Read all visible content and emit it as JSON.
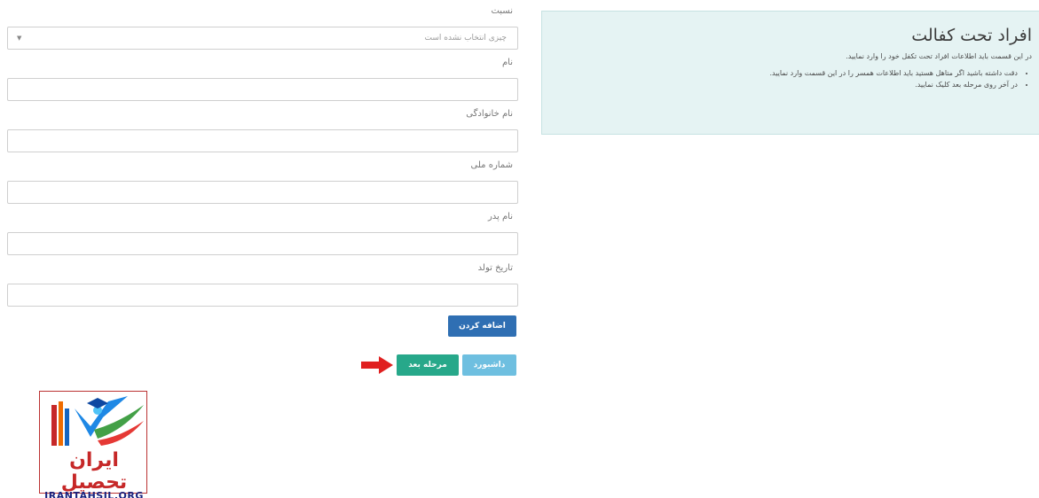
{
  "form": {
    "relation": {
      "label": "نسبت",
      "placeholder": "چیزی انتخاب نشده است"
    },
    "first_name": {
      "label": "نام",
      "value": ""
    },
    "last_name": {
      "label": "نام خانوادگی",
      "value": ""
    },
    "national_id": {
      "label": "شماره ملی",
      "value": ""
    },
    "father_name": {
      "label": "نام پدر",
      "value": ""
    },
    "birth_date": {
      "label": "تاریخ تولد",
      "value": ""
    },
    "add_button": "اضافه کردن",
    "dashboard_button": "داشبورد",
    "next_button": "مرحله بعد"
  },
  "info": {
    "title": "افراد تحت کفالت",
    "intro": "در این قسمت باید اطلاعات افراد تحت تکفل خود را وارد نمایید.",
    "bullets": [
      "دقت داشته باشید اگر متاهل هستید باید اطلاعات همسر را در این قسمت وارد نمایید.",
      "در آخر روی مرحله بعد کلیک نمایید."
    ]
  },
  "logo": {
    "text": "ایران تحصیل",
    "sub": "IRANTAHSIL.ORG"
  },
  "colors": {
    "add": "#2f6fb3",
    "dashboard": "#6ebfe0",
    "next": "#27a88a",
    "arrow": "#e02020",
    "panel": "#e5f3f3"
  }
}
